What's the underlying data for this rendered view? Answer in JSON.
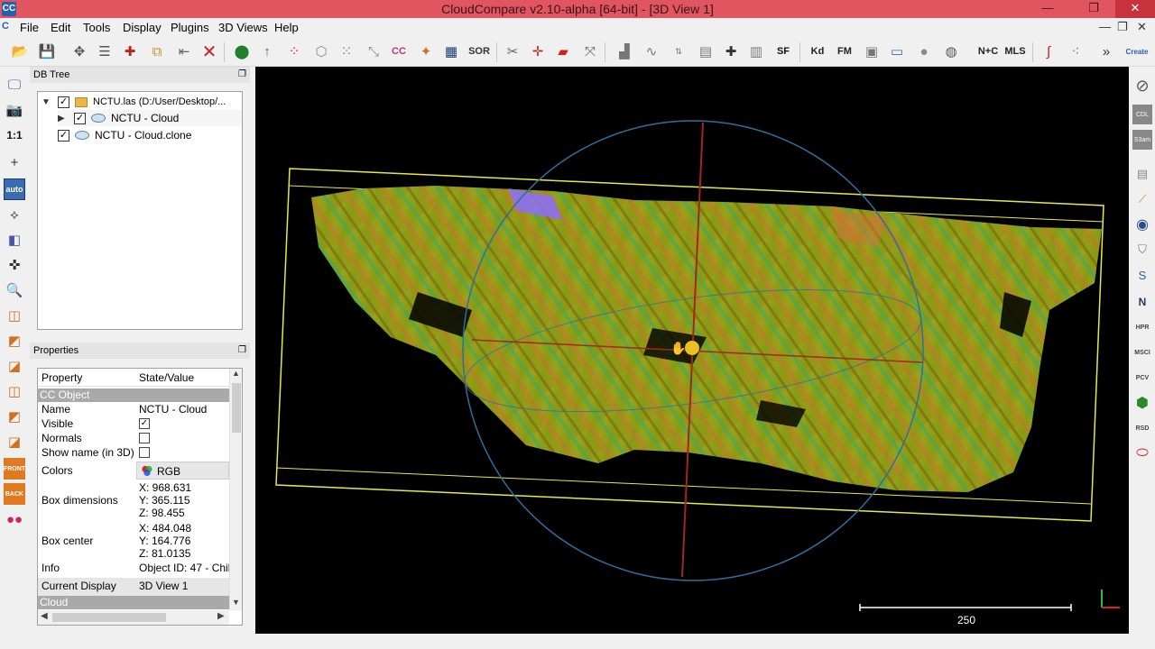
{
  "window": {
    "title": "CloudCompare v2.10-alpha [64-bit] - [3D View 1]",
    "app_icon_text": "CC",
    "min_glyph": "—",
    "max_glyph": "❐",
    "close_glyph": "✕"
  },
  "menu": {
    "items": [
      "File",
      "Edit",
      "Tools",
      "Display",
      "Plugins",
      "3D Views",
      "Help"
    ],
    "right_glyphs": [
      "—",
      "❐",
      "✕"
    ]
  },
  "toolbar": {
    "text_icons": {
      "cc": "CC",
      "sor": "SOR",
      "sf": "SF",
      "kd": "Kd",
      "fm": "FM",
      "nc": "N+C",
      "mls": "MLS",
      "canupo": "Create"
    }
  },
  "left_toolbar": {
    "ratio_label": "1:1",
    "auto_label": "auto",
    "front_label": "FRONT",
    "back_label": "BACK"
  },
  "right_toolbar": {
    "labels": [
      "CDL",
      "S3am",
      "HPR",
      "MSCI",
      "PCV",
      "RSD",
      "N"
    ]
  },
  "db_tree": {
    "title": "DB Tree",
    "items": [
      {
        "label": "NCTU.las (D:/User/Desktop/...",
        "checked": true,
        "level": 0,
        "type": "folder",
        "expanded": true
      },
      {
        "label": "NCTU - Cloud",
        "checked": true,
        "level": 1,
        "type": "cloud",
        "expanded": false
      },
      {
        "label": "NCTU - Cloud.clone",
        "checked": true,
        "level": 1,
        "type": "cloud",
        "expanded": false
      }
    ]
  },
  "properties": {
    "title": "Properties",
    "col_property": "Property",
    "col_value": "State/Value",
    "section_cc": "CC Object",
    "name_key": "Name",
    "name_val": "NCTU - Cloud",
    "visible_key": "Visible",
    "visible_checked": true,
    "normals_key": "Normals",
    "normals_checked": false,
    "showname_key": "Show name (in 3D)",
    "showname_checked": false,
    "colors_key": "Colors",
    "colors_val": "RGB",
    "boxdim_key": "Box dimensions",
    "boxdim_x": "X: 968.631",
    "boxdim_y": "Y: 365.115",
    "boxdim_z": "Z: 98.455",
    "boxcenter_key": "Box center",
    "boxcenter_x": "X: 484.048",
    "boxcenter_y": "Y: 164.776",
    "boxcenter_z": "Z: 81.0135",
    "info_key": "Info",
    "info_val": "Object ID: 47 - Chil",
    "display_key": "Current Display",
    "display_val": "3D View 1",
    "section_cloud": "Cloud"
  },
  "view": {
    "scale_label": "250",
    "bg_color": "#000000",
    "bbox_color": "#e8e84a",
    "sphere_color": "#2f6f9f",
    "axis_color": "#a0281c"
  }
}
